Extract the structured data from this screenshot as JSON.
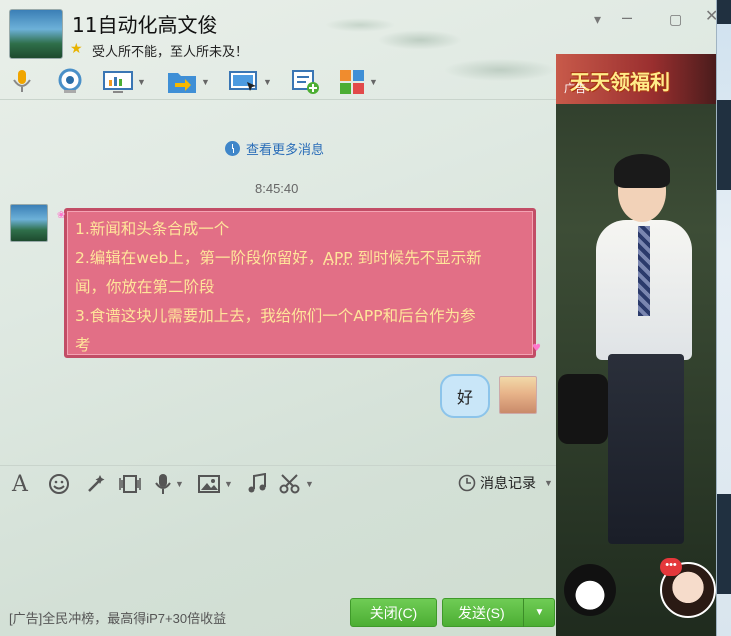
{
  "header": {
    "nickname": "11自动化高文俊",
    "signature": "受人所不能，至人所未及！"
  },
  "toolbar": {
    "icons": [
      "microphone-icon",
      "video-icon",
      "screen-share-icon",
      "file-transfer-icon",
      "remote-desktop-icon",
      "create-group-icon",
      "apps-icon"
    ]
  },
  "chat": {
    "more_messages": "查看更多消息",
    "timestamp": "8:45:40",
    "incoming": {
      "line1": "1.新闻和头条合成一个",
      "line2a": "2.编辑在web上，第一阶段你留好，",
      "line2_app": "APP",
      "line2b": " 到时候先不显示新",
      "line3": "闻，你放在第二阶段",
      "line4": "3.食谱这块儿需要加上去，我给你们一个APP和后台作为参",
      "line5": "考"
    },
    "outgoing": "好"
  },
  "input_toolbar": {
    "history_label": "消息记录"
  },
  "footer": {
    "ad_text": "[广告]全民冲榜，最高得iP7+30倍收益",
    "close_label": "关闭(C)",
    "send_label": "发送(S)"
  },
  "ad_panel": {
    "banner_text": "天天领福利",
    "ad_label": "广告",
    "badge": "•••"
  },
  "colors": {
    "bubble_bg": "#e26f86",
    "bubble_text": "#ffe59a",
    "button_green": "#4cae33",
    "link_blue": "#2a6db8"
  }
}
